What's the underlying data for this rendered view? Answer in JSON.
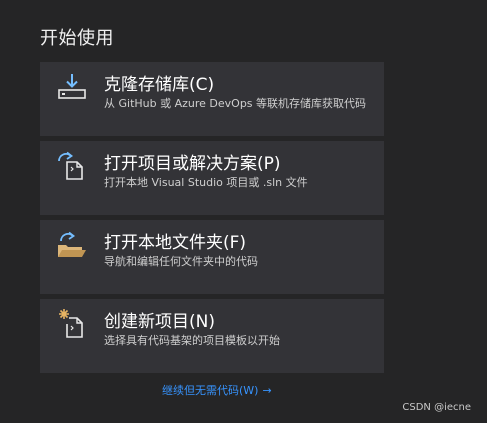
{
  "heading": "开始使用",
  "cards": [
    {
      "title": "克隆存储库(C)",
      "description": "从 GitHub 或 Azure DevOps 等联机存储库获取代码",
      "icon": "clone-download-icon"
    },
    {
      "title": "打开项目或解决方案(P)",
      "description": "打开本地 Visual Studio 项目或 .sln 文件",
      "icon": "open-project-icon"
    },
    {
      "title": "打开本地文件夹(F)",
      "description": "导航和编辑任何文件夹中的代码",
      "icon": "open-folder-icon"
    },
    {
      "title": "创建新项目(N)",
      "description": "选择具有代码基架的项目模板以开始",
      "icon": "new-project-icon"
    }
  ],
  "continue_link": "继续但无需代码(W)",
  "continue_arrow": "→",
  "watermark": "CSDN @iecne",
  "colors": {
    "background": "#252526",
    "card": "#333337",
    "link": "#3794ff",
    "icon_blue": "#75beff",
    "folder_orange": "#dcb67a"
  }
}
